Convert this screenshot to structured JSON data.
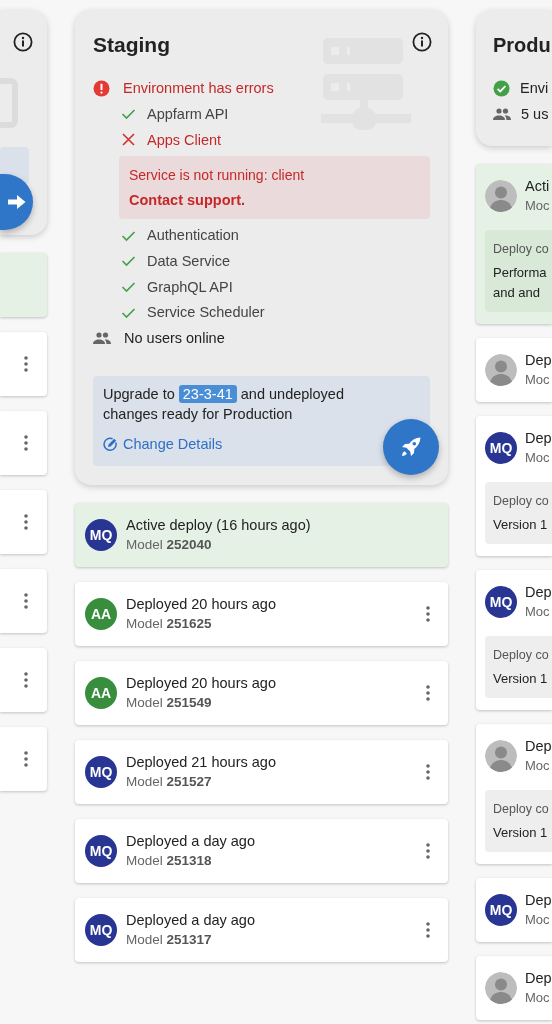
{
  "left_environment": {
    "deploys": [
      {
        "active": true
      },
      {
        "active": false,
        "menu": true
      },
      {
        "active": false,
        "menu": true
      },
      {
        "active": false,
        "menu": true
      },
      {
        "active": false,
        "menu": true
      },
      {
        "active": false,
        "menu": true
      },
      {
        "active": false,
        "menu": true
      }
    ]
  },
  "staging": {
    "title": "Staging",
    "status": {
      "ok": false,
      "text": "Environment has errors"
    },
    "services": [
      {
        "name": "Appfarm API",
        "ok": true
      },
      {
        "name": "Apps Client",
        "ok": false,
        "detail": {
          "message": "Service is not running: client",
          "action": "Contact support."
        }
      },
      {
        "name": "Authentication",
        "ok": true
      },
      {
        "name": "Data Service",
        "ok": true
      },
      {
        "name": "GraphQL API",
        "ok": true
      },
      {
        "name": "Service Scheduler",
        "ok": true
      }
    ],
    "users": "No users online",
    "upgrade": {
      "lead": "Upgrade to",
      "version": "23-3-41",
      "rest": "and undeployed changes ready for Production",
      "link": "Change Details"
    },
    "deploys": [
      {
        "active": true,
        "avatar": {
          "kind": "initials",
          "initials": "MQ",
          "color": "#283593"
        },
        "title": "Active deploy (16 hours ago)",
        "subtitle": "Model **252040**"
      },
      {
        "active": false,
        "menu": true,
        "avatar": {
          "kind": "initials",
          "initials": "AA",
          "color": "#388e3c"
        },
        "title": "Deployed 20 hours ago",
        "subtitle": "Model **251625**"
      },
      {
        "active": false,
        "menu": true,
        "avatar": {
          "kind": "initials",
          "initials": "AA",
          "color": "#388e3c"
        },
        "title": "Deployed 20 hours ago",
        "subtitle": "Model **251549**"
      },
      {
        "active": false,
        "menu": true,
        "avatar": {
          "kind": "initials",
          "initials": "MQ",
          "color": "#283593"
        },
        "title": "Deployed 21 hours ago",
        "subtitle": "Model **251527**"
      },
      {
        "active": false,
        "menu": true,
        "avatar": {
          "kind": "initials",
          "initials": "MQ",
          "color": "#283593"
        },
        "title": "Deployed a day ago",
        "subtitle": "Model **251318**"
      },
      {
        "active": false,
        "menu": true,
        "avatar": {
          "kind": "initials",
          "initials": "MQ",
          "color": "#283593"
        },
        "title": "Deployed a day ago",
        "subtitle": "Model **251317**"
      }
    ]
  },
  "production": {
    "title": "Produ",
    "status": {
      "ok": true,
      "text": "Envi"
    },
    "users": "5 us",
    "deploys": [
      {
        "active": true,
        "avatar": {
          "kind": "photo"
        },
        "title": "Acti",
        "subtitle": "Moc",
        "comment": {
          "label": "Deploy co",
          "lines": [
            "Performa",
            "and and"
          ]
        }
      },
      {
        "active": false,
        "avatar": {
          "kind": "photo"
        },
        "title": "Dep",
        "subtitle": "Moc"
      },
      {
        "active": false,
        "avatar": {
          "kind": "initials",
          "initials": "MQ",
          "color": "#283593"
        },
        "title": "Dep",
        "subtitle": "Moc",
        "comment": {
          "label": "Deploy co",
          "lines": [
            "Version 1"
          ]
        }
      },
      {
        "active": false,
        "avatar": {
          "kind": "initials",
          "initials": "MQ",
          "color": "#283593"
        },
        "title": "Dep",
        "subtitle": "Moc",
        "comment": {
          "label": "Deploy co",
          "lines": [
            "Version 1"
          ]
        }
      },
      {
        "active": false,
        "avatar": {
          "kind": "photo"
        },
        "title": "Dep",
        "subtitle": "Moc",
        "comment": {
          "label": "Deploy co",
          "lines": [
            "Version 1"
          ]
        }
      },
      {
        "active": false,
        "avatar": {
          "kind": "initials",
          "initials": "MQ",
          "color": "#283593"
        },
        "title": "Dep",
        "subtitle": "Moc"
      },
      {
        "active": false,
        "avatar": {
          "kind": "photo"
        },
        "title": "Dep",
        "subtitle": "Moc"
      }
    ]
  }
}
